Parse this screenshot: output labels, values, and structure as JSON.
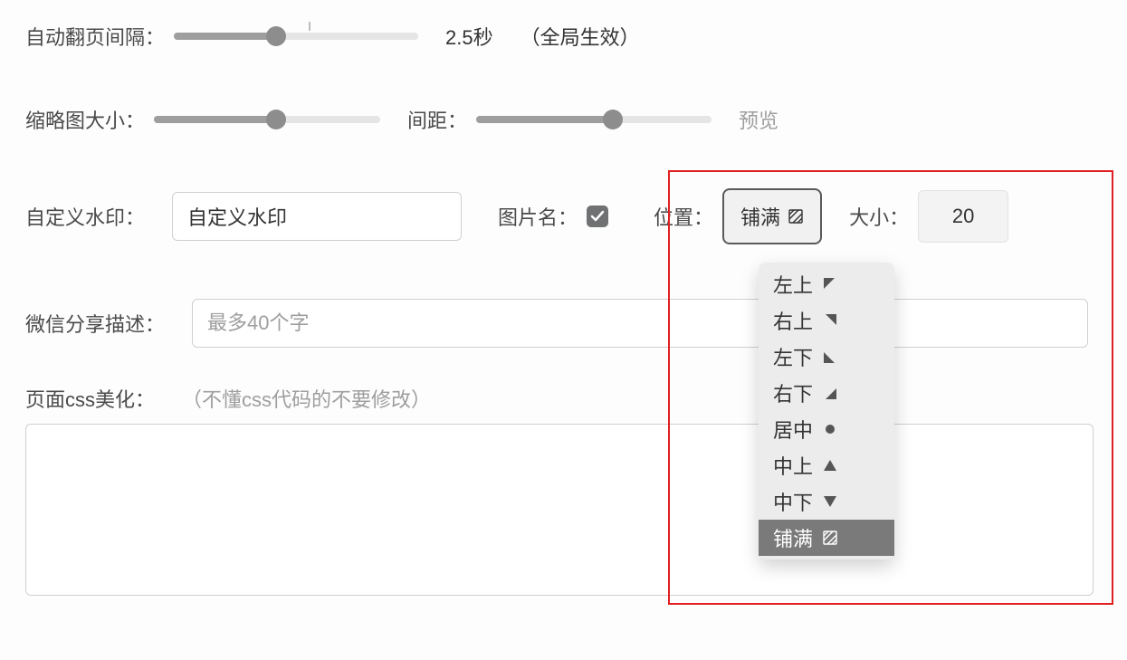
{
  "auto_page": {
    "label": "自动翻页间隔：",
    "value_text": "2.5秒",
    "note": "（全局生效）",
    "fill_pct": 42
  },
  "thumb_size": {
    "label": "缩略图大小：",
    "fill_pct": 54
  },
  "spacing": {
    "label": "间距：",
    "fill_pct": 58,
    "preview_label": "预览"
  },
  "watermark": {
    "label": "自定义水印：",
    "input_value": "自定义水印",
    "image_name_label": "图片名：",
    "image_name_checked": true,
    "position_label": "位置：",
    "position_selected": "铺满",
    "size_label": "大小：",
    "size_value": "20",
    "options": [
      {
        "key": "top-left",
        "label": "左上"
      },
      {
        "key": "top-right",
        "label": "右上"
      },
      {
        "key": "bottom-left",
        "label": "左下"
      },
      {
        "key": "bottom-right",
        "label": "右下"
      },
      {
        "key": "center",
        "label": "居中"
      },
      {
        "key": "top-center",
        "label": "中上"
      },
      {
        "key": "bottom-center",
        "label": "中下"
      },
      {
        "key": "fill",
        "label": "铺满"
      }
    ]
  },
  "wechat_desc": {
    "label": "微信分享描述：",
    "placeholder": "最多40个字"
  },
  "css_beautify": {
    "label": "页面css美化：",
    "hint": "（不懂css代码的不要修改）"
  }
}
